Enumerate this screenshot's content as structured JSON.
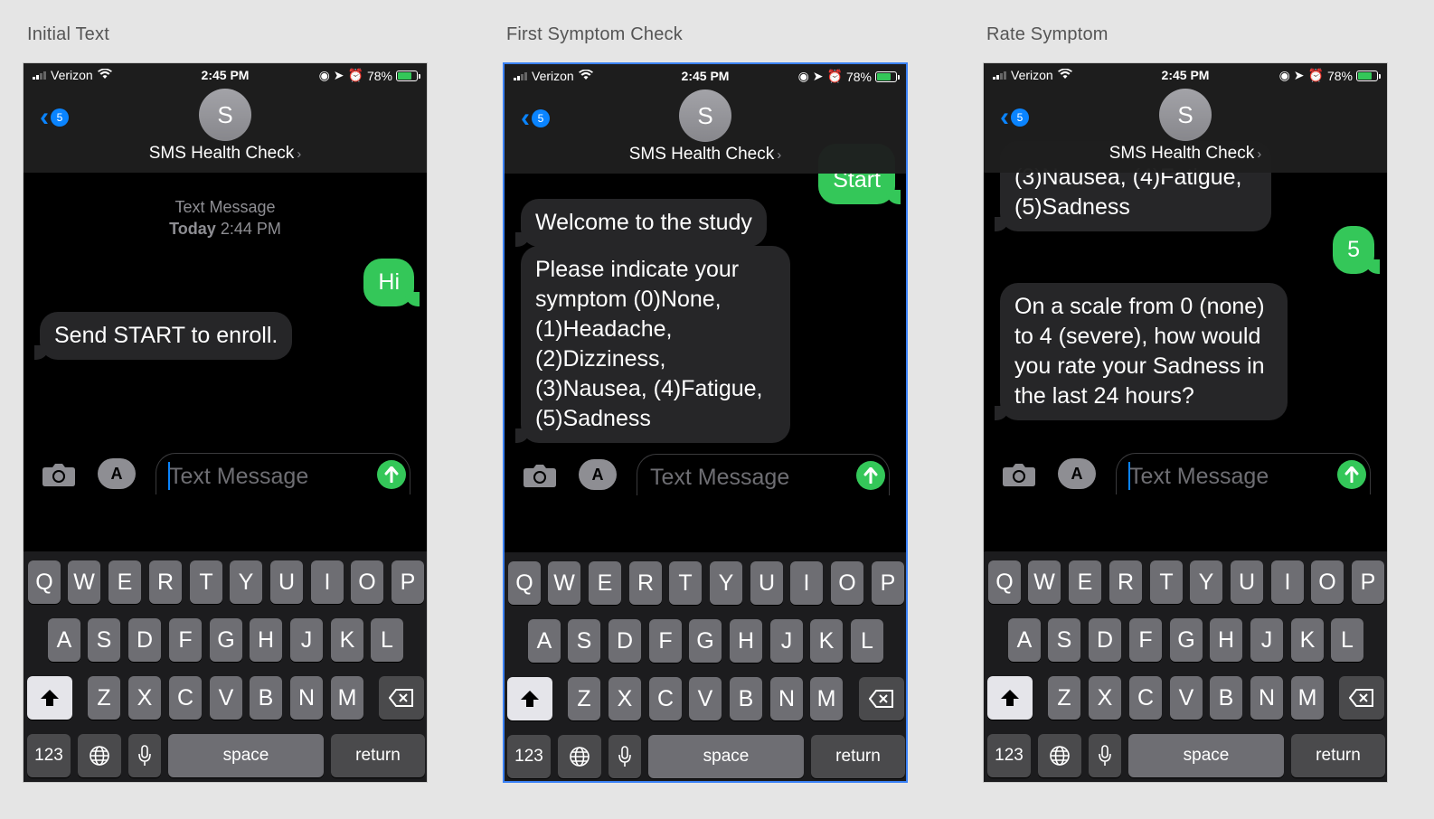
{
  "frames": [
    {
      "title": "Initial Text",
      "status": {
        "carrier": "Verizon",
        "time": "2:45 PM",
        "battery": "78%"
      },
      "nav": {
        "back_badge": "5",
        "avatar_initial": "S",
        "contact_name": "SMS Health Check"
      },
      "timestamp": {
        "label": "Text Message",
        "day": "Today",
        "time": "2:44 PM"
      },
      "messages": [
        {
          "dir": "out",
          "text": "Hi"
        },
        {
          "dir": "in",
          "text": "Send START to enroll."
        }
      ],
      "input": {
        "placeholder": "Text Message"
      }
    },
    {
      "title": "First Symptom Check",
      "status": {
        "carrier": "Verizon",
        "time": "2:45 PM",
        "battery": "78%"
      },
      "nav": {
        "back_badge": "5",
        "avatar_initial": "S",
        "contact_name": "SMS Health Check"
      },
      "messages": [
        {
          "dir": "out",
          "text": "Start"
        },
        {
          "dir": "in",
          "text": "Welcome to the study"
        },
        {
          "dir": "in",
          "text": "Please indicate your symptom (0)None, (1)Headache, (2)Dizziness, (3)Nausea, (4)Fatigue, (5)Sadness"
        }
      ],
      "input": {
        "placeholder": "Text Message"
      }
    },
    {
      "title": "Rate Symptom",
      "status": {
        "carrier": "Verizon",
        "time": "2:45 PM",
        "battery": "78%"
      },
      "nav": {
        "back_badge": "5",
        "avatar_initial": "S",
        "contact_name": "SMS Health Check"
      },
      "messages": [
        {
          "dir": "in",
          "text": "(3)Nausea, (4)Fatigue, (5)Sadness"
        },
        {
          "dir": "out",
          "text": "5"
        },
        {
          "dir": "in",
          "text": "On a scale from 0 (none) to 4 (severe), how would you rate your Sadness in the last 24 hours?"
        }
      ],
      "input": {
        "placeholder": "Text Message"
      }
    }
  ],
  "keyboard": {
    "row1": [
      "Q",
      "W",
      "E",
      "R",
      "T",
      "Y",
      "U",
      "I",
      "O",
      "P"
    ],
    "row2": [
      "A",
      "S",
      "D",
      "F",
      "G",
      "H",
      "J",
      "K",
      "L"
    ],
    "row3": [
      "Z",
      "X",
      "C",
      "V",
      "B",
      "N",
      "M"
    ],
    "numbers": "123",
    "space": "space",
    "return": "return"
  },
  "icons": [
    "signal-icon",
    "wifi-icon",
    "battery-icon",
    "back-chevron-icon",
    "camera-icon",
    "app-store-icon",
    "send-arrow-icon",
    "shift-icon",
    "backspace-icon",
    "globe-icon",
    "microphone-icon"
  ],
  "colors": {
    "imessage_green": "#34c759",
    "ios_blue": "#0a84ff",
    "incoming_bubble": "#262628",
    "selection_border": "#3b82f6"
  }
}
